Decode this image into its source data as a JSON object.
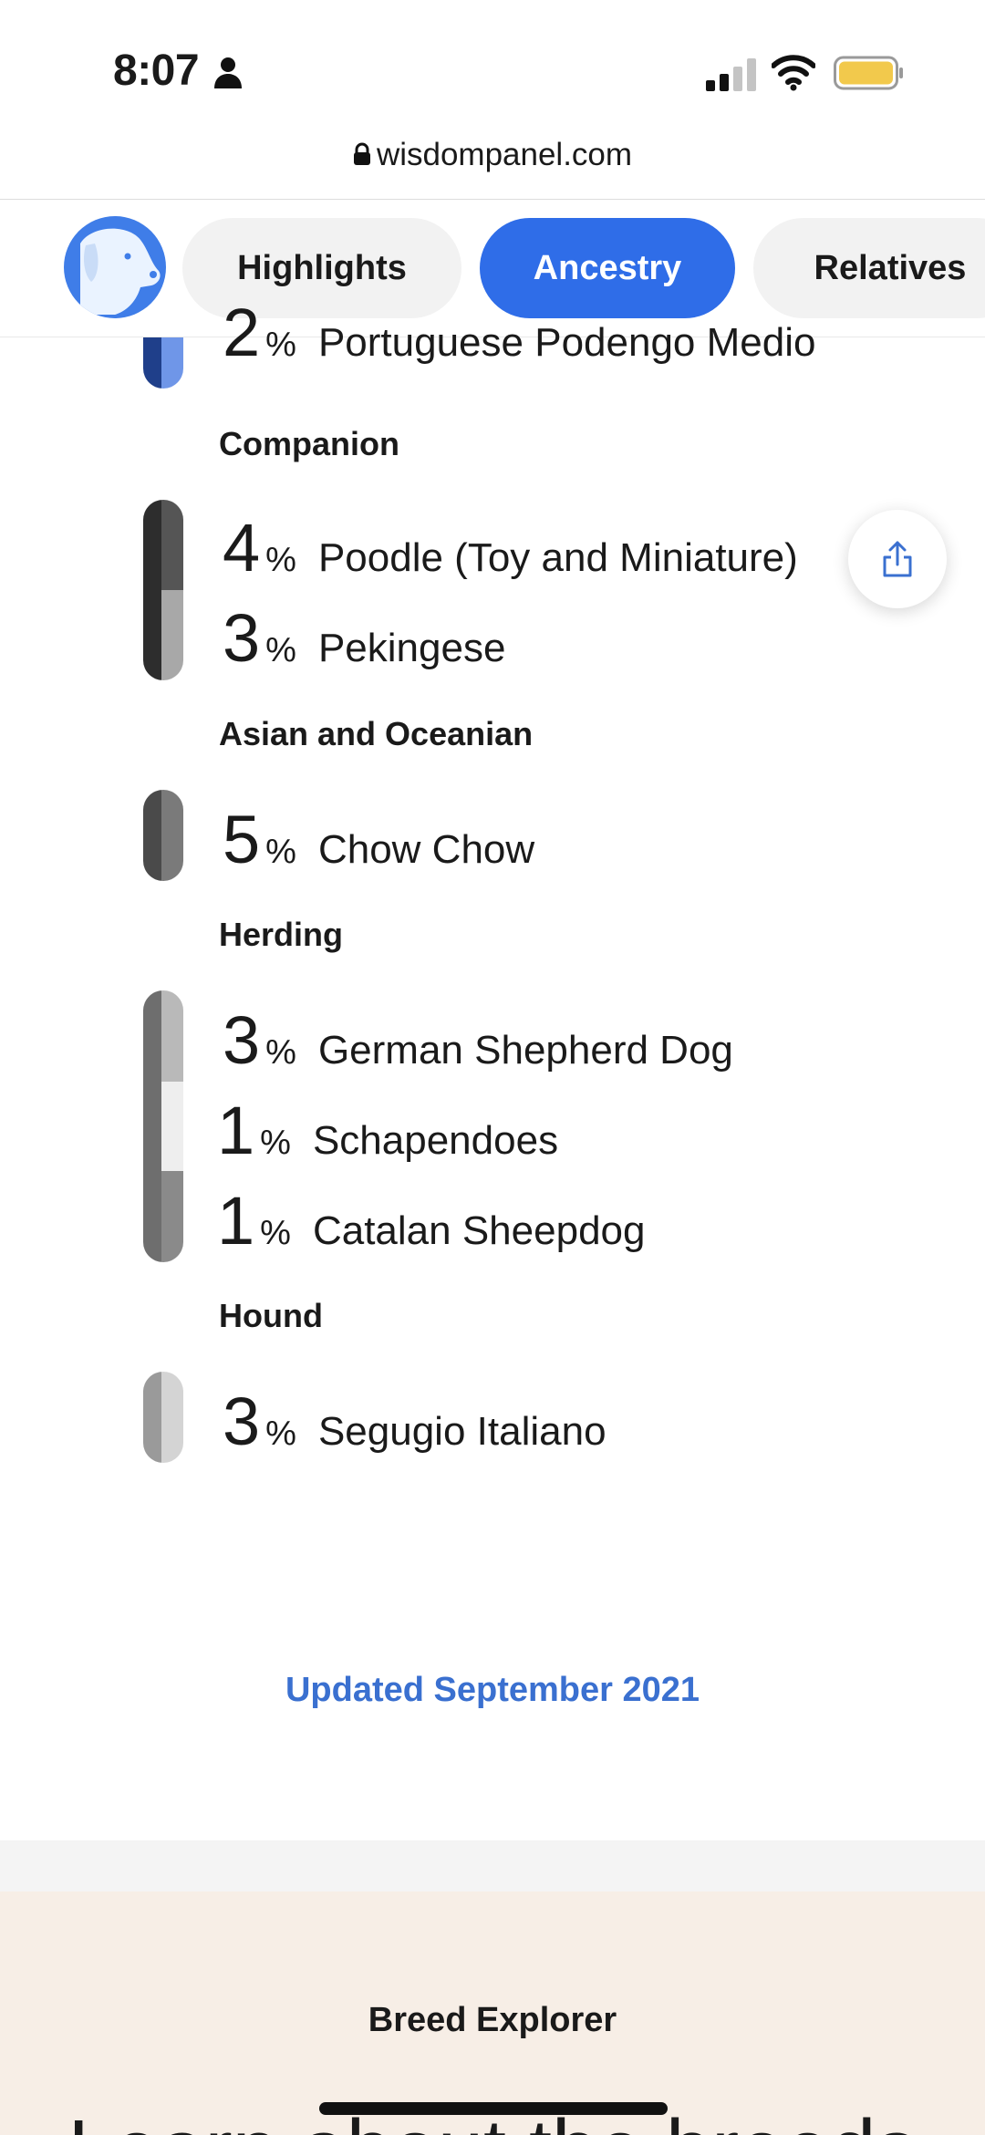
{
  "status_bar": {
    "time": "8:07",
    "icons": [
      "person-icon",
      "cellular-signal-icon",
      "wifi-icon",
      "battery-icon"
    ],
    "battery_color": "#f2c94c"
  },
  "browser": {
    "url": "wisdompanel.com",
    "lock_icon": "lock-icon"
  },
  "nav": {
    "logo_icon": "dog-logo-icon",
    "tabs": [
      {
        "label": "Highlights",
        "active": false
      },
      {
        "label": "Ancestry",
        "active": true
      },
      {
        "label": "Relatives",
        "active": false
      }
    ],
    "active_color": "#2f6de8"
  },
  "ancestry": {
    "partial_row": {
      "percent": "2",
      "sign": "%",
      "breed": "Portuguese Podengo Medio",
      "bar_color": "#1f3f8a"
    },
    "groups": [
      {
        "heading": "Companion",
        "breeds": [
          {
            "percent": "4",
            "sign": "%",
            "breed": "Poodle (Toy and Miniature)"
          },
          {
            "percent": "3",
            "sign": "%",
            "breed": "Pekingese"
          }
        ]
      },
      {
        "heading": "Asian and Oceanian",
        "breeds": [
          {
            "percent": "5",
            "sign": "%",
            "breed": "Chow Chow"
          }
        ]
      },
      {
        "heading": "Herding",
        "breeds": [
          {
            "percent": "3",
            "sign": "%",
            "breed": "German Shepherd Dog"
          },
          {
            "percent": "1",
            "sign": "%",
            "breed": "Schapendoes"
          },
          {
            "percent": "1",
            "sign": "%",
            "breed": "Catalan Sheepdog"
          }
        ]
      },
      {
        "heading": "Hound",
        "breeds": [
          {
            "percent": "3",
            "sign": "%",
            "breed": "Segugio Italiano"
          }
        ]
      }
    ]
  },
  "share_button_icon": "share-icon",
  "updated_text": "Updated September 2021",
  "breed_explorer": {
    "title": "Breed Explorer",
    "heading": "Learn about the breeds"
  }
}
